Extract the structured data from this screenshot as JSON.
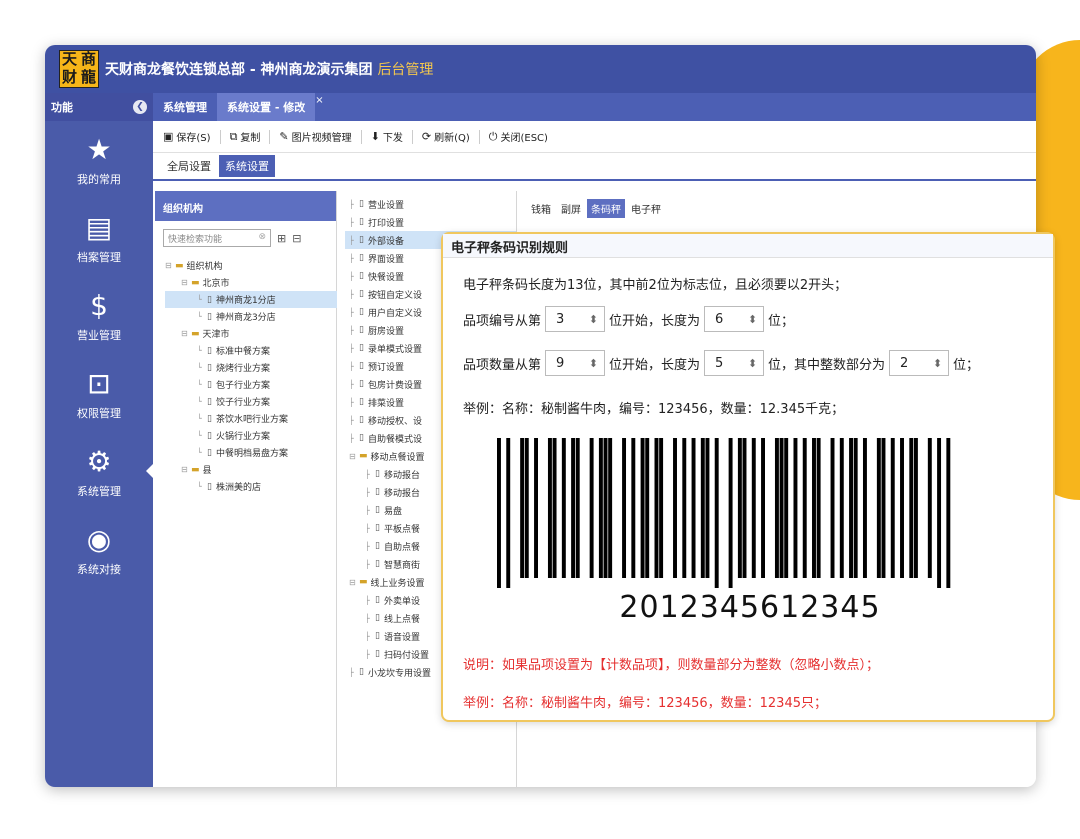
{
  "window": {
    "title_main": "天财商龙餐饮连锁总部 - 神州商龙演示集团",
    "title_suffix": "后台管理",
    "logo_chars": [
      "天",
      "商",
      "财",
      "龍"
    ]
  },
  "tabs": {
    "func_label": "功能",
    "items": [
      {
        "label": "系统管理",
        "active": false
      },
      {
        "label": "系统设置 - 修改",
        "active": true
      }
    ]
  },
  "leftnav": [
    {
      "label": "我的常用",
      "icon": "star-icon",
      "glyph": "★"
    },
    {
      "label": "档案管理",
      "icon": "archive-icon",
      "glyph": "▤"
    },
    {
      "label": "营业管理",
      "icon": "money-bag-icon",
      "glyph": "$"
    },
    {
      "label": "权限管理",
      "icon": "permission-icon",
      "glyph": "⊡"
    },
    {
      "label": "系统管理",
      "icon": "gears-icon",
      "glyph": "⚙"
    },
    {
      "label": "系统对接",
      "icon": "broadcast-icon",
      "glyph": "◉"
    }
  ],
  "toolbar": [
    {
      "label": "保存(S)",
      "icon": "save-icon",
      "glyph": "▣"
    },
    {
      "label": "复制",
      "icon": "copy-icon",
      "glyph": "⧉"
    },
    {
      "label": "图片视频管理",
      "icon": "media-icon",
      "glyph": "✎"
    },
    {
      "label": "下发",
      "icon": "download-icon",
      "glyph": "⬇"
    },
    {
      "label": "刷新(Q)",
      "icon": "refresh-icon",
      "glyph": "⟳"
    },
    {
      "label": "关闭(ESC)",
      "icon": "close-icon",
      "glyph": "⏻"
    }
  ],
  "subtabs": [
    {
      "label": "全局设置",
      "active": false
    },
    {
      "label": "系统设置",
      "active": true
    }
  ],
  "org": {
    "heading": "组织机构",
    "search_placeholder": "快速检索功能",
    "tree": [
      {
        "label": "组织机构",
        "level": 0,
        "folder": true
      },
      {
        "label": "北京市",
        "level": 1,
        "folder": true
      },
      {
        "label": "神州商龙1分店",
        "level": 2,
        "folder": false,
        "selected": true
      },
      {
        "label": "神州商龙3分店",
        "level": 2,
        "folder": false
      },
      {
        "label": "天津市",
        "level": 1,
        "folder": true
      },
      {
        "label": "标准中餐方案",
        "level": 2,
        "folder": false
      },
      {
        "label": "烧烤行业方案",
        "level": 2,
        "folder": false
      },
      {
        "label": "包子行业方案",
        "level": 2,
        "folder": false
      },
      {
        "label": "饺子行业方案",
        "level": 2,
        "folder": false
      },
      {
        "label": "茶饮水吧行业方案",
        "level": 2,
        "folder": false
      },
      {
        "label": "火锅行业方案",
        "level": 2,
        "folder": false
      },
      {
        "label": "中餐明档易盘方案",
        "level": 2,
        "folder": false
      },
      {
        "label": "县",
        "level": 1,
        "folder": true
      },
      {
        "label": "株洲美的店",
        "level": 2,
        "folder": false
      }
    ]
  },
  "settings_list": [
    {
      "label": "营业设置",
      "level": 0
    },
    {
      "label": "打印设置",
      "level": 0
    },
    {
      "label": "外部设备",
      "level": 0,
      "selected": true
    },
    {
      "label": "界面设置",
      "level": 0
    },
    {
      "label": "快餐设置",
      "level": 0
    },
    {
      "label": "按钮自定义设",
      "level": 0
    },
    {
      "label": "用户自定义设",
      "level": 0
    },
    {
      "label": "厨房设置",
      "level": 0
    },
    {
      "label": "录单模式设置",
      "level": 0
    },
    {
      "label": "预订设置",
      "level": 0
    },
    {
      "label": "包房计费设置",
      "level": 0
    },
    {
      "label": "排菜设置",
      "level": 0
    },
    {
      "label": "移动授权、设",
      "level": 0
    },
    {
      "label": "自助餐模式设",
      "level": 0
    },
    {
      "label": "移动点餐设置",
      "level": 0,
      "folder": true
    },
    {
      "label": "移动报台",
      "level": 1
    },
    {
      "label": "移动报台",
      "level": 1
    },
    {
      "label": "易盘",
      "level": 1
    },
    {
      "label": "平板点餐",
      "level": 1
    },
    {
      "label": "自助点餐",
      "level": 1
    },
    {
      "label": "智慧商街",
      "level": 1
    },
    {
      "label": "线上业务设置",
      "level": 0,
      "folder": true
    },
    {
      "label": "外卖单设",
      "level": 1
    },
    {
      "label": "线上点餐",
      "level": 1
    },
    {
      "label": "语音设置",
      "level": 1
    },
    {
      "label": "扫码付设置",
      "level": 1
    },
    {
      "label": "小龙坎专用设置",
      "level": 0
    }
  ],
  "right_tabs": [
    {
      "label": "钱箱",
      "active": false
    },
    {
      "label": "副屏",
      "active": false
    },
    {
      "label": "条码秤",
      "active": true
    },
    {
      "label": "电子秤",
      "active": false
    }
  ],
  "popup": {
    "title": "电子秤条码识别规则",
    "line1": "电子秤条码长度为13位，其中前2位为标志位，且必须要以2开头；",
    "line2": {
      "a": "品项编号从第",
      "v1": "3",
      "b": "位开始，长度为",
      "v2": "6",
      "c": "位；"
    },
    "line3": {
      "a": "品项数量从第",
      "v1": "9",
      "b": "位开始，长度为",
      "v2": "5",
      "c": "位，其中整数部分为",
      "v3": "2",
      "d": "位；"
    },
    "example1": "举例：名称：秘制酱牛肉，编号：123456，数量：12.345千克；",
    "barcode_number": "2012345612345",
    "note": "说明：如果品项设置为【计数品项】，则数量部分为整数（忽略小数点）；",
    "example2": "举例：名称：秘制酱牛肉，编号：123456，数量：12345只；",
    "colors": {
      "note": "#e52f2f",
      "border": "#f0c75e"
    }
  }
}
